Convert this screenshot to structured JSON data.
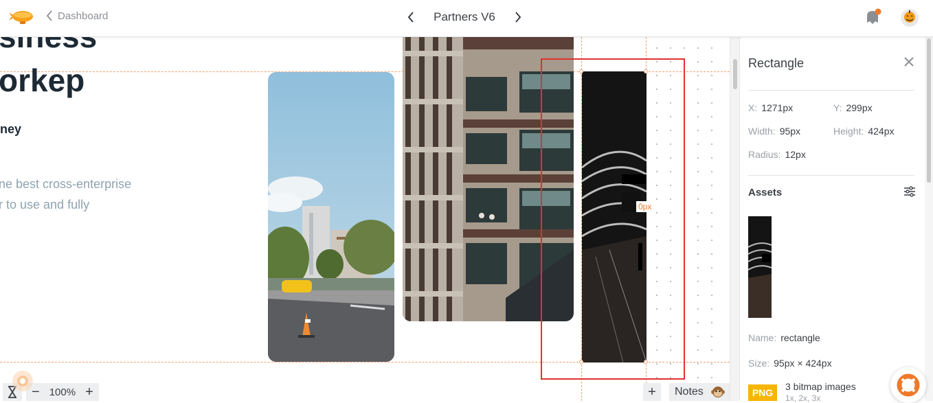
{
  "header": {
    "back_label": "Dashboard",
    "project_title": "Partners V6"
  },
  "canvas": {
    "hero_line1": "siness",
    "hero_line2": "orkep",
    "subheading": "ney",
    "body_line1": "ne best cross-enterprise",
    "body_line2": "r to use and fully",
    "spacing_label": "0px"
  },
  "toolbar": {
    "zoom_minus": "−",
    "zoom_level": "100%",
    "zoom_plus": "+",
    "add_label": "+",
    "notes_label": "Notes"
  },
  "inspector": {
    "title": "Rectangle",
    "x_label": "X:",
    "x_value": "1271px",
    "y_label": "Y:",
    "y_value": "299px",
    "width_label": "Width:",
    "width_value": "95px",
    "height_label": "Height:",
    "height_value": "424px",
    "radius_label": "Radius:",
    "radius_value": "12px",
    "assets_title": "Assets",
    "name_label": "Name:",
    "name_value": "rectangle",
    "size_label": "Size:",
    "size_value": "95px × 424px",
    "format_badge": "PNG",
    "bitmap_label": "3 bitmap images",
    "bitmap_scales": "1x, 2x, 3x"
  },
  "colors": {
    "accent_orange": "#ee7a2a",
    "selection_red": "#e03030",
    "png_badge": "#f7b500"
  }
}
